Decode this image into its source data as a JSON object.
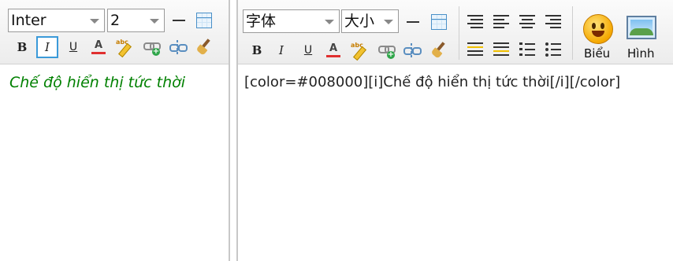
{
  "left_editor": {
    "font_select": {
      "value": "Inter"
    },
    "size_select": {
      "value": "2"
    },
    "buttons": {
      "bold": "B",
      "italic": "I",
      "underline": "U",
      "text_color": "A",
      "spellcheck_text": "abc"
    },
    "content": {
      "text": "Chế độ hiển thị tức thời",
      "color": "#008000"
    }
  },
  "right_editor": {
    "font_select": {
      "value": "字体"
    },
    "size_select": {
      "value": "大小"
    },
    "buttons": {
      "bold": "B",
      "italic": "I",
      "underline": "U",
      "text_color": "A",
      "spellcheck_text": "abc"
    },
    "insert_buttons": {
      "emoticon_label": "Biểu",
      "image_label": "Hình"
    },
    "content": {
      "text": "[color=#008000][i]Chế độ hiển thị tức thời[/i][/color]"
    }
  },
  "icons": [
    "horizontal-rule-icon",
    "table-icon",
    "spellcheck-icon",
    "insert-link-icon",
    "unlink-icon",
    "clear-format-brush-icon",
    "align-left-icon",
    "align-center-icon",
    "align-right-icon",
    "justify-icon",
    "indent-icon",
    "outdent-icon",
    "numbered-list-icon",
    "bullet-list-icon",
    "smiley-icon",
    "image-icon"
  ],
  "colors": {
    "active_border": "#3b9ad9",
    "green_text": "#008000",
    "toolbar_bg": "#f1f1f1"
  }
}
